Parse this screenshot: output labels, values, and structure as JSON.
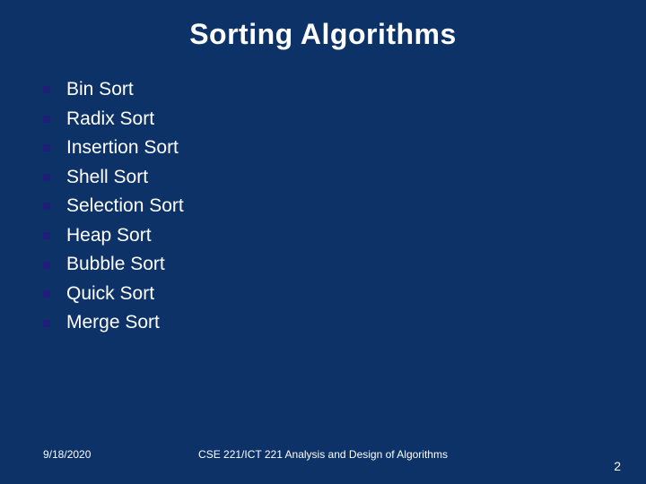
{
  "title": "Sorting Algorithms",
  "items": [
    "Bin Sort",
    "Radix Sort",
    "Insertion Sort",
    "Shell Sort",
    "Selection Sort",
    "Heap Sort",
    "Bubble Sort",
    "Quick Sort",
    "Merge Sort"
  ],
  "footer": {
    "date": "9/18/2020",
    "course": "CSE 221/ICT 221 Analysis and Design of Algorithms",
    "page": "2"
  }
}
